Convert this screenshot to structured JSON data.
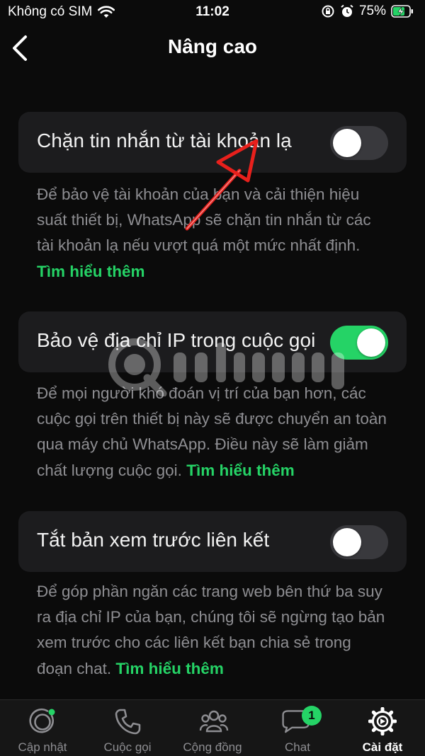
{
  "status_bar": {
    "carrier": "Không có SIM",
    "time": "11:02",
    "battery_percent": "75%",
    "icons": [
      "wifi-icon",
      "orientation-lock-icon",
      "alarm-icon",
      "battery-charging-icon"
    ]
  },
  "nav": {
    "title": "Nâng cao",
    "back_icon": "chevron-left-icon"
  },
  "settings": [
    {
      "label": "Chặn tin nhắn từ tài khoản lạ",
      "enabled": false,
      "description": "Để bảo vệ tài khoản của bạn và cải thiện hiệu suất thiết bị, WhatsApp sẽ chặn tin nhắn từ các tài khoản lạ nếu vượt quá một mức nhất định.",
      "link": "Tìm hiểu thêm"
    },
    {
      "label": "Bảo vệ địa chỉ IP trong cuộc gọi",
      "enabled": true,
      "description": "Để mọi người khó đoán vị trí của bạn hơn, các cuộc gọi trên thiết bị này sẽ được chuyển an toàn qua máy chủ WhatsApp. Điều này sẽ làm giảm chất lượng cuộc gọi.",
      "link": "Tìm hiểu thêm"
    },
    {
      "label": "Tắt bản xem trước liên kết",
      "enabled": false,
      "description": "Để góp phần ngăn các trang web bên thứ ba suy ra địa chỉ IP của bạn, chúng tôi sẽ ngừng tạo bản xem trước cho các liên kết bạn chia sẻ trong đoạn chat.",
      "link": "Tìm hiểu thêm"
    }
  ],
  "tabs": [
    {
      "label": "Cập nhật",
      "icon": "updates-icon",
      "active": false
    },
    {
      "label": "Cuộc gọi",
      "icon": "phone-icon",
      "active": false
    },
    {
      "label": "Cộng đồng",
      "icon": "community-icon",
      "active": false
    },
    {
      "label": "Chat",
      "icon": "chat-icon",
      "active": false,
      "badge": "1"
    },
    {
      "label": "Cài đặt",
      "icon": "settings-gear-icon",
      "active": true
    }
  ],
  "colors": {
    "background": "#0b0b0b",
    "card": "#1c1c1e",
    "accent": "#25d366",
    "secondary_text": "#8e8e92",
    "annotation_arrow": "#e8201c"
  }
}
